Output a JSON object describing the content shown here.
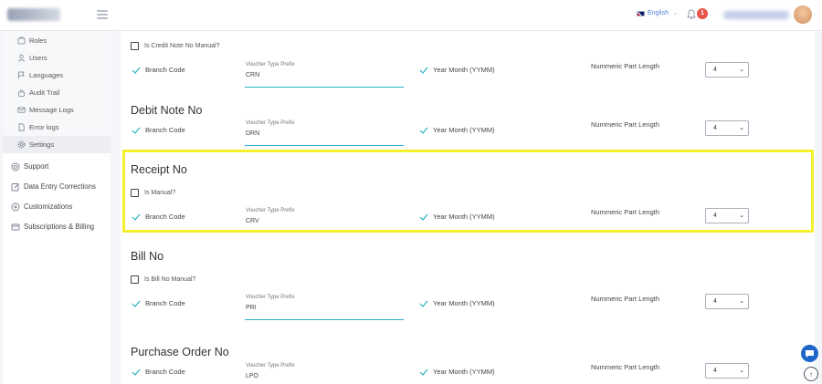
{
  "topbar": {
    "language": "English",
    "notification_count": "1"
  },
  "sidebar": {
    "sub_items": [
      {
        "label": "Roles",
        "icon": "roles-icon"
      },
      {
        "label": "Users",
        "icon": "users-icon"
      },
      {
        "label": "Languages",
        "icon": "flag-icon"
      },
      {
        "label": "Audit Trail",
        "icon": "lock-icon"
      },
      {
        "label": "Message Logs",
        "icon": "mail-icon"
      },
      {
        "label": "Error logs",
        "icon": "document-icon"
      },
      {
        "label": "Settings",
        "icon": "gear-icon"
      }
    ],
    "main_items": [
      {
        "label": "Support",
        "icon": "support-icon"
      },
      {
        "label": "Data Entry Corrections",
        "icon": "edit-icon"
      },
      {
        "label": "Customizations",
        "icon": "plus-circle-icon"
      },
      {
        "label": "Subscriptions & Billing",
        "icon": "billing-icon"
      }
    ]
  },
  "common": {
    "branch_code": "Branch Code",
    "voucher_prefix_label": "Voucher Type Prefix",
    "year_month": "Year Month (YYMM)",
    "numeric_part_length": "Nummeric Part Length"
  },
  "sections": {
    "credit": {
      "checkbox": "Is Credit Note No Manual?",
      "prefix": "CRN",
      "length": "4"
    },
    "debit": {
      "title": "Debit Note No",
      "prefix": "DRN",
      "length": "4"
    },
    "receipt": {
      "title": "Receipt No",
      "checkbox": "Is Manual?",
      "prefix": "CRV",
      "length": "4"
    },
    "bill": {
      "title": "Bill No",
      "checkbox": "Is Bill No Manual?",
      "prefix": "PRI",
      "length": "4"
    },
    "po": {
      "title": "Purchase Order No",
      "prefix": "LPO",
      "length": "4"
    }
  },
  "colors": {
    "accent_teal": "#2ab3c0",
    "highlight": "#f4f02b",
    "badge_red": "#e8534b",
    "chat_blue": "#1e66c7"
  }
}
